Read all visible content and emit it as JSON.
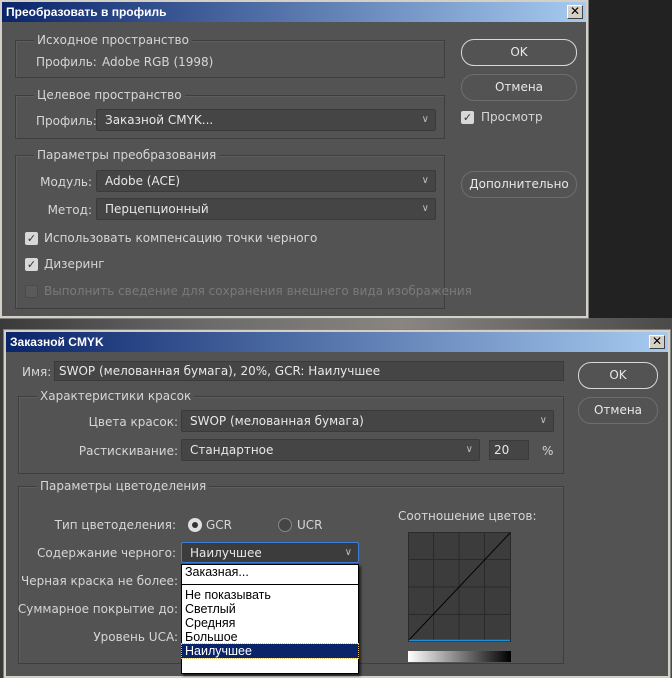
{
  "dialog1": {
    "title": "Преобразовать в профиль",
    "source": {
      "legend": "Исходное пространство",
      "profile_label": "Профиль:",
      "profile_value": "Adobe RGB (1998)"
    },
    "dest": {
      "legend": "Целевое пространство",
      "profile_label": "Профиль:",
      "profile_value": "Заказной CMYK..."
    },
    "conv": {
      "legend": "Параметры преобразования",
      "engine_label": "Модуль:",
      "engine_value": "Adobe (ACE)",
      "intent_label": "Метод:",
      "intent_value": "Перцепционный",
      "bpc_label": "Использовать компенсацию точки черного",
      "dither_label": "Дизеринг",
      "flatten_label": "Выполнить сведение для сохранения внешнего вида изображения"
    },
    "ok": "OK",
    "cancel": "Отмена",
    "preview": "Просмотр",
    "advanced": "Дополнительно"
  },
  "dialog2": {
    "title": "Заказной CMYK",
    "name_label": "Имя:",
    "name_value": "SWOP (мелованная бумага), 20%, GCR: Наилучшее",
    "ok": "OK",
    "cancel": "Отмена",
    "inks": {
      "legend": "Характеристики красок",
      "colors_label": "Цвета красок:",
      "colors_value": "SWOP (мелованная бумага)",
      "gain_label": "Растискивание:",
      "gain_value": "Стандартное",
      "gain_amount": "20",
      "percent": "%"
    },
    "sep": {
      "legend": "Параметры цветоделения",
      "type_label": "Тип цветоделения:",
      "gcr": "GCR",
      "ucr": "UCR",
      "black_label": "Содержание черного:",
      "black_value": "Наилучшее",
      "black_limit_label": "Черная краска не более:",
      "total_label": "Суммарное покрытие до:",
      "uca_label": "Уровень UCA:",
      "graph_label": "Соотношение цветов:"
    },
    "dropdown": [
      "Заказная...",
      "Не показывать",
      "Светлый",
      "Средняя",
      "Большое",
      "Наилучшее"
    ]
  }
}
